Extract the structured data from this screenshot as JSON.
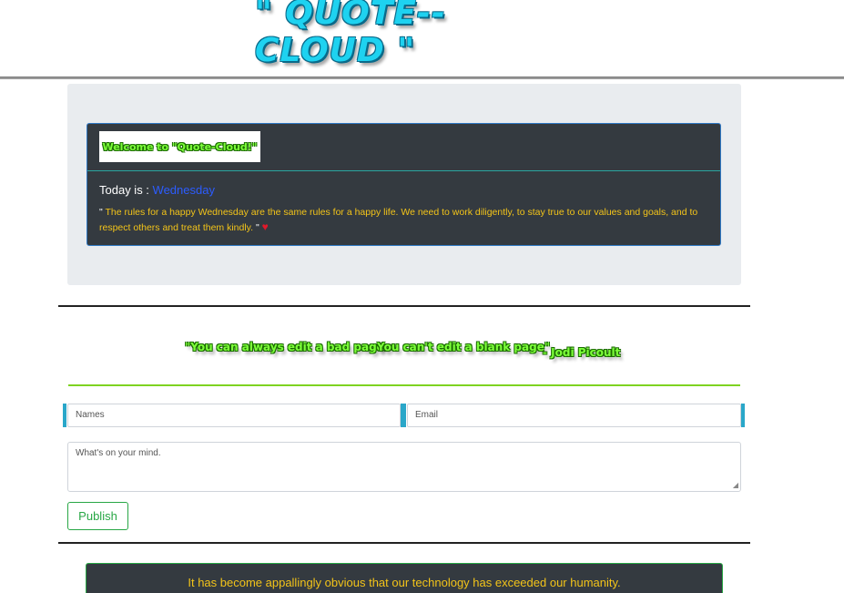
{
  "header": {
    "logo_text": "\" QUOTE--CLOUD \""
  },
  "welcome_card": {
    "badge_text": "Welcome to \"Quote-Cloud!\"",
    "today_label": "Today is :",
    "today_value": "Wednesday",
    "quote_open": "\"",
    "quote_text": "The rules for a happy Wednesday are the same rules for a happy life. We need to work diligently, to stay true to our values and goals, and to respect others and treat them kindly.",
    "quote_close": "\"",
    "heart": "♥"
  },
  "banner": {
    "part1": "\"You can always edit a bad page.",
    "part2": "You can't edit a blank page\"",
    "author": "- Jodi Picoult"
  },
  "form": {
    "name_placeholder": "Names",
    "email_placeholder": "Email",
    "message_placeholder": "What's on your mind.",
    "publish_label": "Publish"
  },
  "footer": {
    "quote": "It has become appallingly obvious that our technology has exceeded our humanity."
  },
  "colors": {
    "accent_teal": "#2aa7c9",
    "card_bg": "#343a40",
    "quote_yellow": "#f3c419",
    "green": "#28a745",
    "logo_cyan": "#1ed2f0"
  }
}
